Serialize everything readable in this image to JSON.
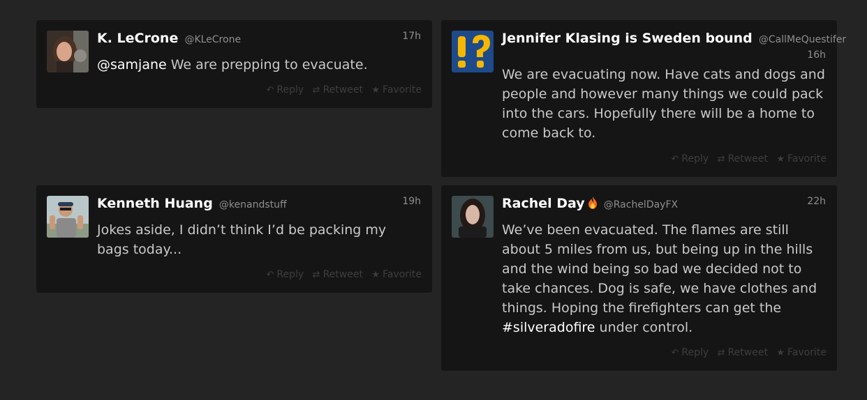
{
  "tweets": [
    {
      "name": "K. LeCrone",
      "handle": "@KLeCrone",
      "time": "17h",
      "mention": "@samjane",
      "text": " We are prepping to evacuate."
    },
    {
      "name": "Jennifer Klasing is Sweden bound",
      "handle": "@CallMeQuestifer",
      "time": "16h",
      "text": "We are evacuating now. Have cats and dogs and people and however many things we could pack into the cars. Hopefully there will be a home to come back to."
    },
    {
      "name": "Kenneth Huang",
      "handle": "@kenandstuff",
      "time": "19h",
      "text": "Jokes aside, I didn’t think I’d be packing my bags today..."
    },
    {
      "name": "Rachel Day",
      "handle": "@RachelDayFX",
      "time": "22h",
      "text_before": "We’ve been evacuated. The flames are still about 5 miles from us, but being up in the hills and the wind being so bad we decided not to take chances. Dog is safe, we have clothes and things. Hoping the firefighters can get the ",
      "hashtag": "#silveradofire",
      "text_after": " under control."
    }
  ],
  "actions": {
    "reply": "Reply",
    "retweet": "Retweet",
    "favorite": "Favorite",
    "reply_icon": "reply-icon",
    "retweet_icon": "retweet-icon",
    "favorite_icon": "star-icon"
  },
  "colors": {
    "background": "#242424",
    "card": "#151515",
    "name": "#ffffff",
    "meta": "#8f8f8f",
    "body_text": "#c9c9c9",
    "actions": "#3e3e3e"
  }
}
